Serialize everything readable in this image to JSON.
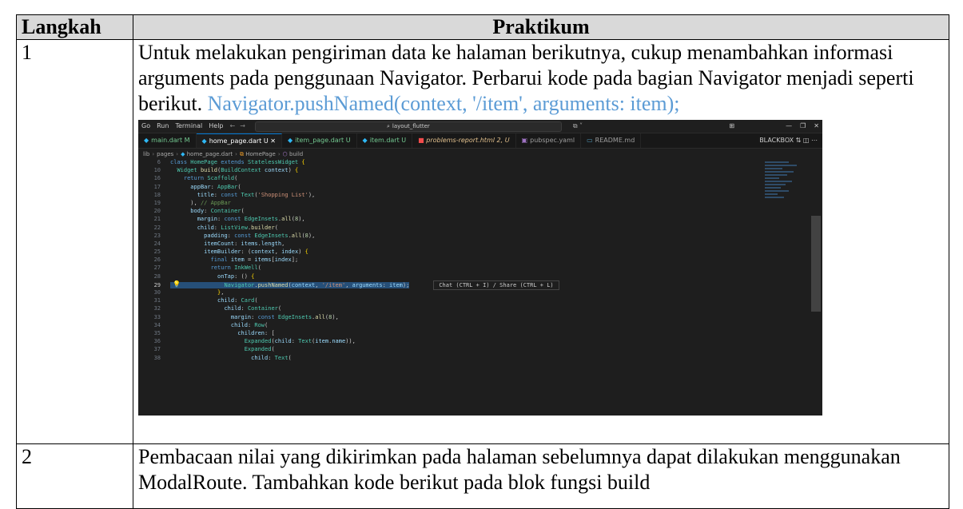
{
  "table": {
    "header": {
      "col1": "Langkah",
      "col2": "Praktikum"
    },
    "rows": [
      {
        "step": "1",
        "text": "Untuk melakukan pengiriman data ke halaman berikutnya, cukup menambahkan informasi arguments pada penggunaan Navigator. Perbarui kode pada bagian Navigator menjadi seperti berikut.",
        "code_inline": "Navigator.pushNamed(context, '/item', arguments: item);"
      },
      {
        "step": "2",
        "text": "Pembacaan nilai yang dikirimkan pada halaman sebelumnya dapat dilakukan menggunakan ModalRoute. Tambahkan kode berikut pada blok fungsi build"
      }
    ]
  },
  "vscode": {
    "menu": [
      "Go",
      "Run",
      "Terminal",
      "Help"
    ],
    "search": "layout_flutter",
    "tabs": [
      {
        "label": "main.dart",
        "status": "M"
      },
      {
        "label": "home_page.dart",
        "status": "U",
        "active": true
      },
      {
        "label": "item_page.dart",
        "status": "U"
      },
      {
        "label": "item.dart",
        "status": "U"
      },
      {
        "label": "problems-report.html",
        "status": "2, U"
      },
      {
        "label": "pubspec.yaml",
        "status": ""
      },
      {
        "label": "README.md",
        "status": ""
      }
    ],
    "tab_right_label": "BLACKBOX",
    "breadcrumb": [
      "lib",
      "pages",
      "home_page.dart",
      "HomePage",
      "build"
    ],
    "hint": "Chat (CTRL + I) / Share (CTRL + L)",
    "line_numbers": [
      "6",
      "10",
      "16",
      "17",
      "18",
      "19",
      "20",
      "21",
      "22",
      "23",
      "24",
      "25",
      "26",
      "27",
      "28",
      "29",
      "30",
      "31",
      "32",
      "33",
      "34",
      "35",
      "36",
      "37",
      "38"
    ]
  }
}
